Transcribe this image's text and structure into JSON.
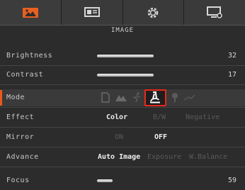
{
  "tabs": [
    {
      "icon": "image-icon",
      "active": true
    },
    {
      "icon": "presentation-icon",
      "active": false
    },
    {
      "icon": "gear-icon",
      "active": false
    },
    {
      "icon": "monitor-settings-icon",
      "active": false
    }
  ],
  "section_title": "IMAGE",
  "rows": {
    "brightness": {
      "label": "Brightness",
      "value": "32"
    },
    "contrast": {
      "label": "Contrast",
      "value": "17"
    },
    "mode": {
      "label": "Mode",
      "icons": [
        "document-icon",
        "landscape-icon",
        "sports-icon",
        "microscope-icon",
        "macro-icon",
        "infinity-icon"
      ],
      "selected": "microscope-icon"
    },
    "effect": {
      "label": "Effect",
      "options": [
        "Color",
        "B/W",
        "Negative"
      ],
      "selected": "Color"
    },
    "mirror": {
      "label": "Mirror",
      "options": [
        "ON",
        "OFF"
      ],
      "selected": "OFF"
    },
    "advance": {
      "label": "Advance",
      "options": [
        "Auto Image",
        "Exposure",
        "W.Balance"
      ],
      "selected": "Auto Image"
    },
    "focus": {
      "label": "Focus",
      "value": "59"
    }
  },
  "colors": {
    "accent": "#e85a1b",
    "selection_box": "#e8291d"
  }
}
